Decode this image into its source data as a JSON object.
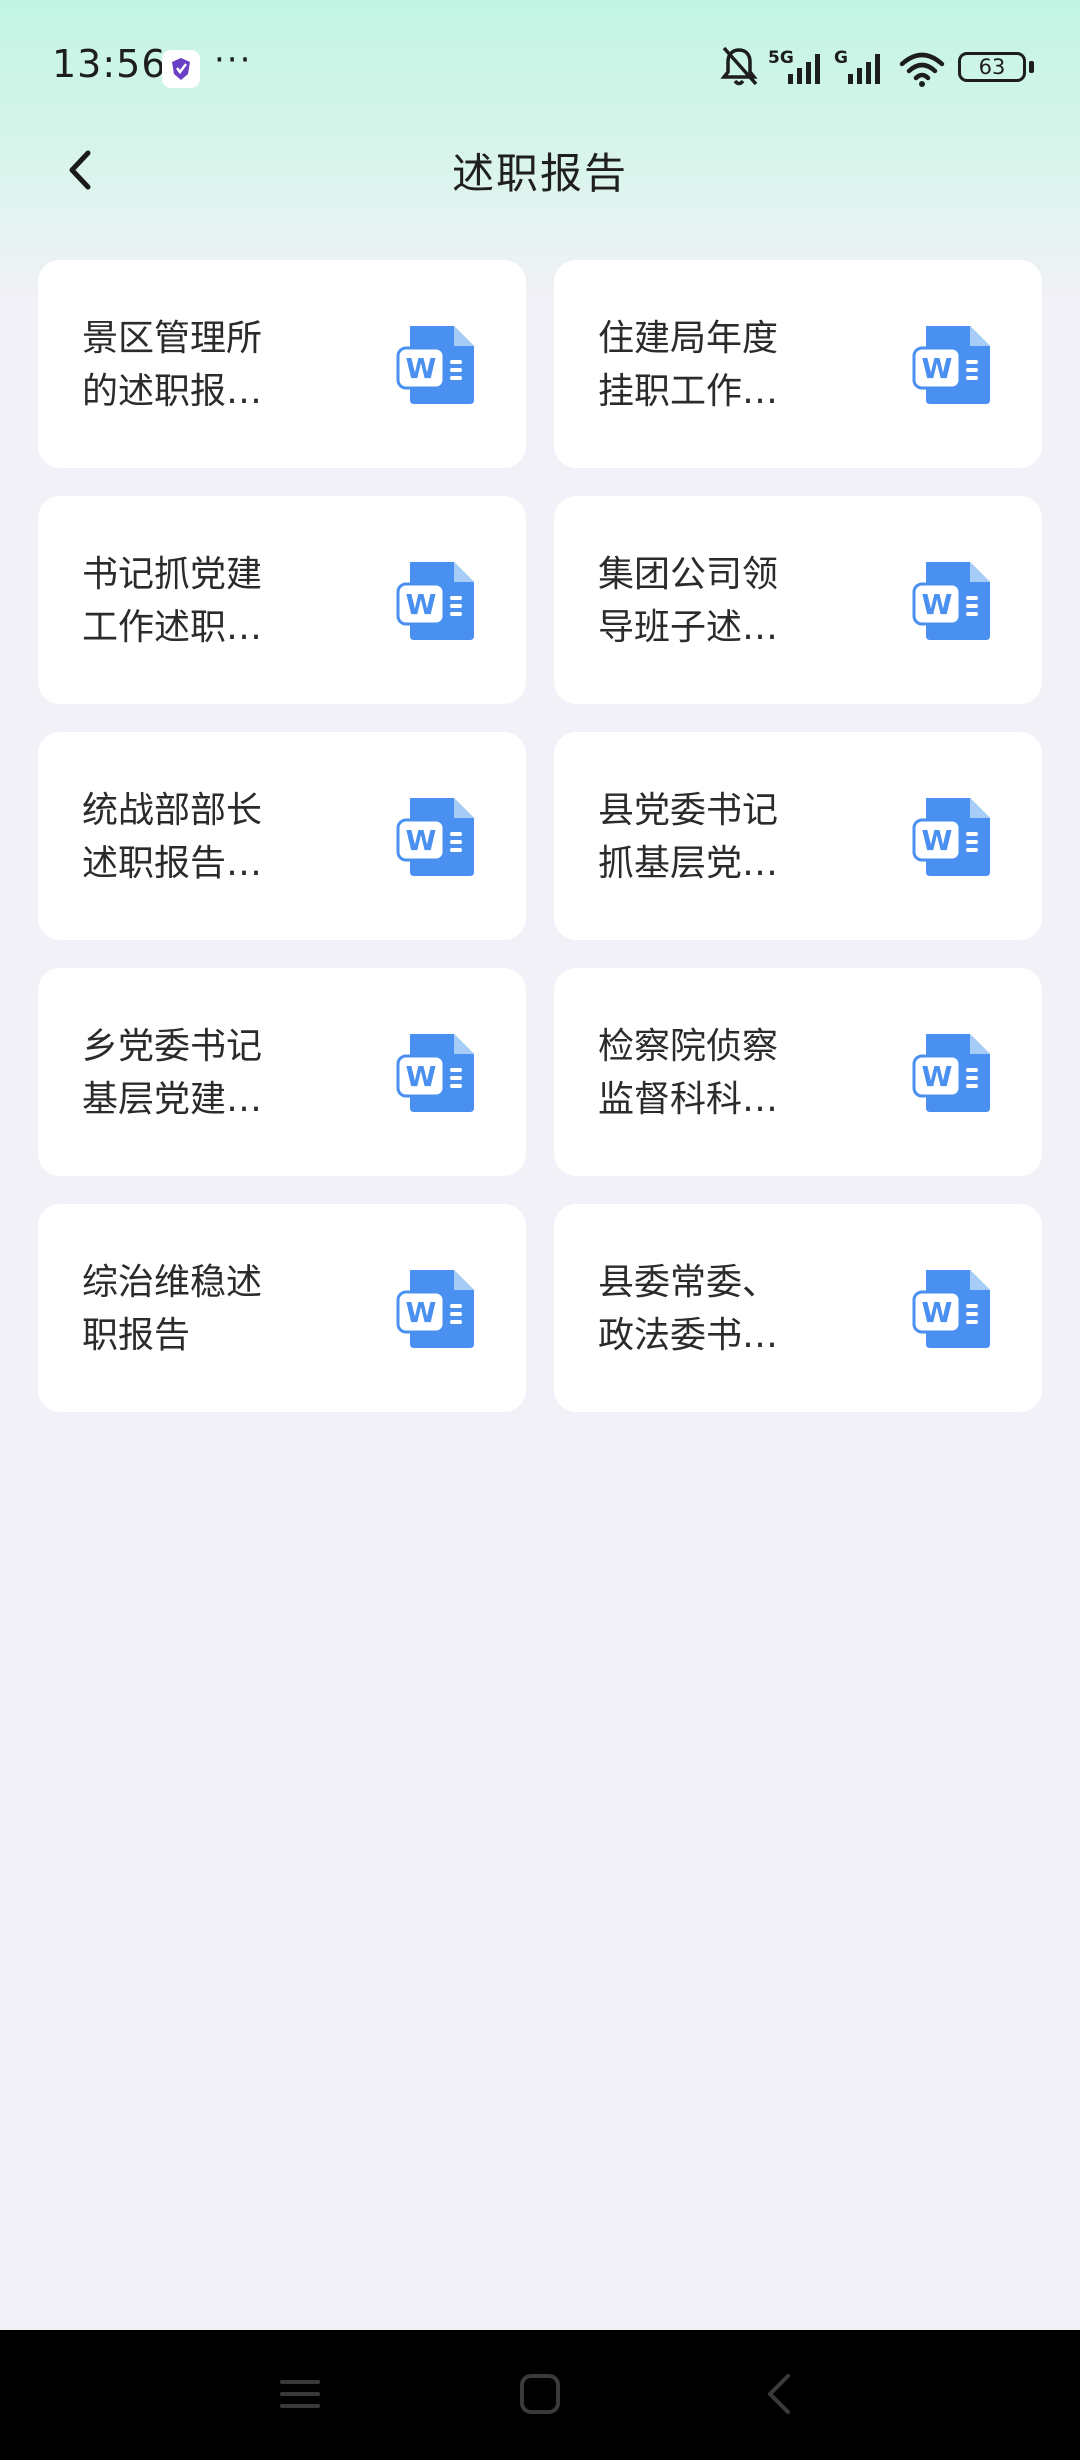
{
  "status_bar": {
    "time": "13:56",
    "more": "···",
    "battery": "63",
    "signal_labels": [
      "5G",
      "G"
    ]
  },
  "header": {
    "title": "述职报告"
  },
  "cards": [
    {
      "title": "景区管理所的述职报…",
      "icon": "word-doc-icon"
    },
    {
      "title": "住建局年度挂职工作…",
      "icon": "word-doc-icon"
    },
    {
      "title": "书记抓党建工作述职…",
      "icon": "word-doc-icon"
    },
    {
      "title": "集团公司领导班子述…",
      "icon": "word-doc-icon"
    },
    {
      "title": "统战部部长述职报告…",
      "icon": "word-doc-icon"
    },
    {
      "title": "县党委书记抓基层党…",
      "icon": "word-doc-icon"
    },
    {
      "title": "乡党委书记基层党建…",
      "icon": "word-doc-icon"
    },
    {
      "title": "检察院侦察监督科科…",
      "icon": "word-doc-icon"
    },
    {
      "title": "综治维稳述职报告",
      "icon": "word-doc-icon"
    },
    {
      "title": "县委常委、政法委书…",
      "icon": "word-doc-icon"
    }
  ],
  "nav": {
    "items": [
      "menu-icon",
      "home-icon",
      "back-icon"
    ]
  },
  "colors": {
    "accent_blue": "#4a90f0",
    "header_gradient_top": "#c3f5e4",
    "background": "#f2f1f7"
  }
}
